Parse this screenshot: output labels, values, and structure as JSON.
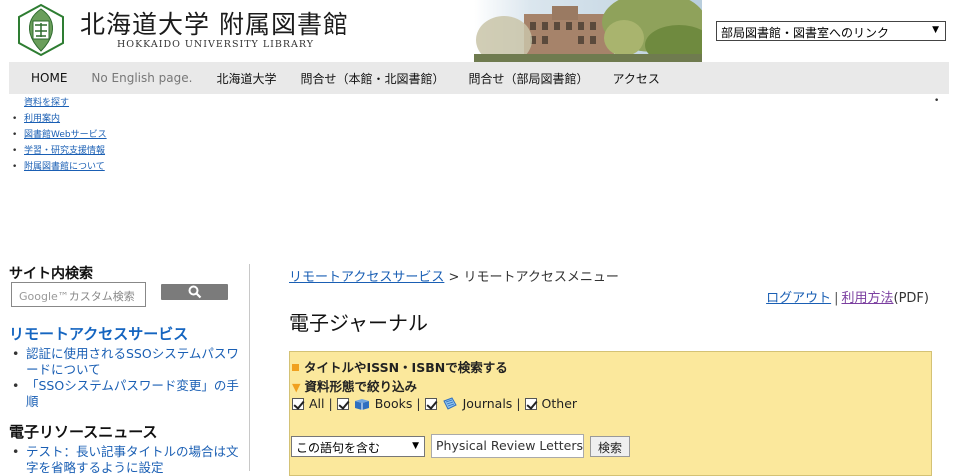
{
  "header": {
    "title": "北海道大学 附属図書館",
    "subtitle": "HOKKAIDO UNIVERSITY LIBRARY",
    "dept_select": "部局図書館・図書室へのリンク"
  },
  "nav": [
    {
      "label": "HOME",
      "muted": false
    },
    {
      "label": "No English page.",
      "muted": true
    },
    {
      "label": "北海道大学",
      "muted": false
    },
    {
      "label": "問合せ（本館・北図書館）",
      "muted": false
    },
    {
      "label": "問合せ（部局図書館）",
      "muted": false
    },
    {
      "label": "アクセス",
      "muted": false
    }
  ],
  "mini_links": [
    "資料を探す",
    "利用案内",
    "図書館Webサービス",
    "学習・研究支援情報",
    "附属図書館について"
  ],
  "sidebar": {
    "search_heading": "サイト内検索",
    "search_placeholder_brand": "Google™",
    "search_placeholder": "カスタム検索",
    "remote_heading": "リモートアクセスサービス",
    "remote_links": [
      "認証に使用されるSSOシステムパスワードについて",
      "「SSOシステムパスワード変更」の手順"
    ],
    "news_heading": "電子リソースニュース",
    "news_links": [
      "テスト：長い記事タイトルの場合は文字を省略するように設定"
    ]
  },
  "main": {
    "breadcrumb_link": "リモートアクセスサービス",
    "breadcrumb_sep": " > ",
    "breadcrumb_current": "リモートアクセスメニュー",
    "logout": "ログアウト",
    "link_sep": "|",
    "usage": "利用方法",
    "usage_suffix": "(PDF)",
    "page_title": "電子ジャーナル",
    "panel": {
      "search_heading": "タイトルやISSN・ISBNで検索する",
      "filter_heading": "資料形態で絞り込み",
      "filters": {
        "all": "All",
        "books": "Books",
        "journals": "Journals",
        "other": "Other"
      },
      "pipe": "|",
      "match_select": "この語句を含む",
      "query": "Physical Review Letters",
      "search_button": "検索"
    }
  },
  "colors": {
    "accent": "#1565c0",
    "panel_bg": "#fbe89c",
    "bullet_orange": "#f0a020",
    "nav_bg": "#e9e9e9"
  }
}
